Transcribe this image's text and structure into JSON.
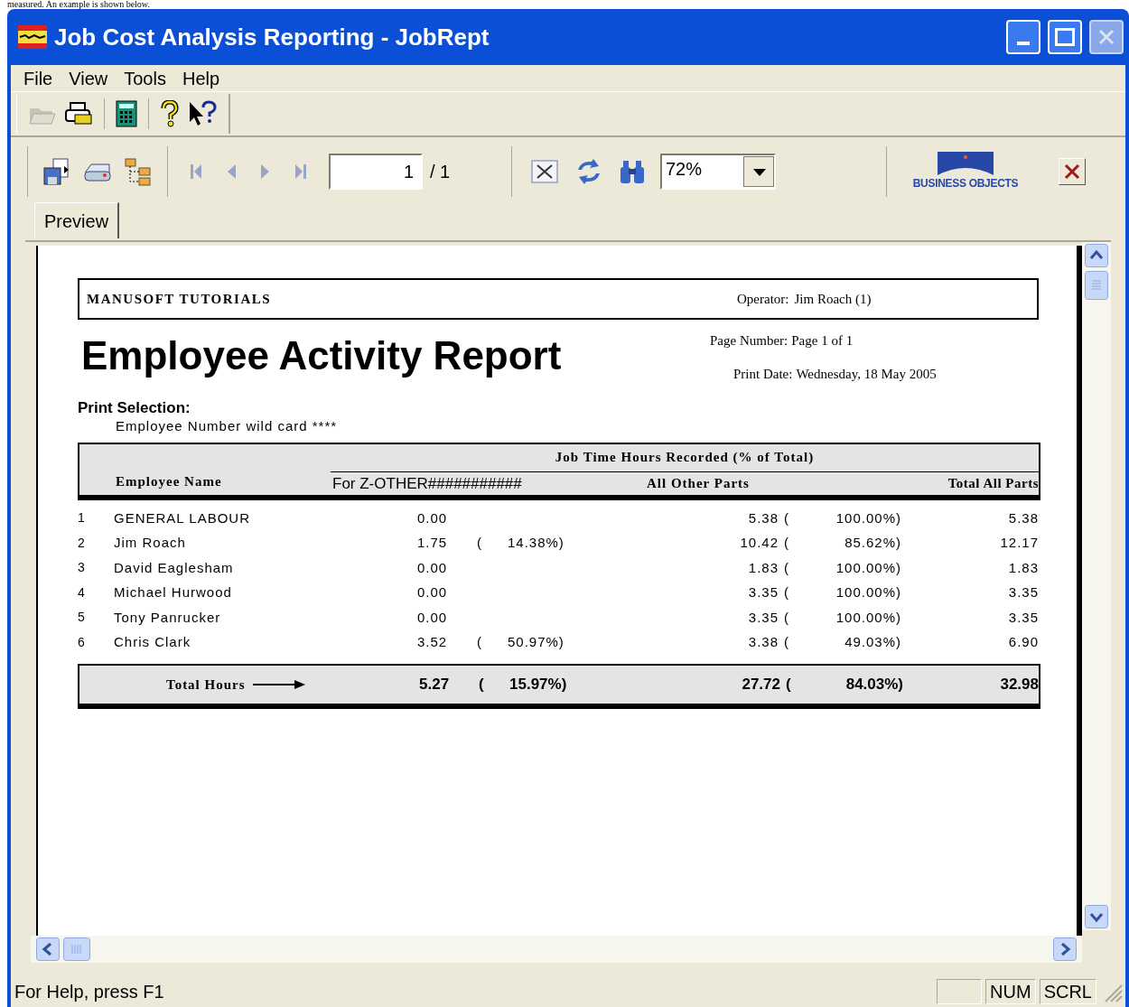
{
  "document_text": "measured. An example is shown below.",
  "window": {
    "title": "Job Cost Analysis Reporting - JobRept"
  },
  "menu": [
    "File",
    "View",
    "Tools",
    "Help"
  ],
  "navigator": {
    "page": "1",
    "total": "/ 1",
    "zoom": "72%"
  },
  "logo": {
    "text": "BUSINESS OBJECTS"
  },
  "tabs": [
    {
      "label": "Preview",
      "selected": true
    }
  ],
  "report": {
    "company": "MANUSOFT TUTORIALS",
    "operator_label": "Operator:",
    "operator": "Jim Roach (1)",
    "title": "Employee Activity Report",
    "page_label": "Page Number:",
    "page": "Page 1 of 1",
    "date_label": "Print Date:",
    "date": "Wednesday, 18 May 2005",
    "selection_label": "Print Selection:",
    "selection": "Employee Number wild card ****",
    "group_heading": "Job Time Hours Recorded (% of Total)",
    "columns": [
      "Employee Name",
      "For Z-OTHER###########",
      "All Other Parts",
      "Total All Parts"
    ],
    "rows": [
      {
        "number": "1",
        "name": "GENERAL LABOUR",
        "z_hours": "0.00",
        "other_hours": "5.38",
        "other_open": "(",
        "other_pct": "100.00%)",
        "total": "5.38"
      },
      {
        "number": "2",
        "name": "Jim Roach",
        "z_hours": "1.75",
        "z_open": "(",
        "z_pct": "14.38%)",
        "other_hours": "10.42",
        "other_open": "(",
        "other_pct": "85.62%)",
        "total": "12.17"
      },
      {
        "number": "3",
        "name": "David Eaglesham",
        "z_hours": "0.00",
        "other_hours": "1.83",
        "other_open": "(",
        "other_pct": "100.00%)",
        "total": "1.83"
      },
      {
        "number": "4",
        "name": "Michael Hurwood",
        "z_hours": "0.00",
        "other_hours": "3.35",
        "other_open": "(",
        "other_pct": "100.00%)",
        "total": "3.35"
      },
      {
        "number": "5",
        "name": "Tony Panrucker",
        "z_hours": "0.00",
        "other_hours": "3.35",
        "other_open": "(",
        "other_pct": "100.00%)",
        "total": "3.35"
      },
      {
        "number": "6",
        "name": "Chris Clark",
        "z_hours": "3.52",
        "z_open": "(",
        "z_pct": "50.97%)",
        "other_hours": "3.38",
        "other_open": "(",
        "other_pct": "49.03%)",
        "total": "6.90"
      }
    ],
    "totals": {
      "label": "Total Hours",
      "z_hours": "5.27",
      "z_open": "(",
      "z_pct": "15.97%)",
      "other_hours": "27.72",
      "other_open": "(",
      "other_pct": "84.03%)",
      "total": "32.98"
    }
  },
  "status_bar": {
    "text": "For Help, press F1",
    "indicators": [
      "NUM",
      "SCRL"
    ]
  }
}
